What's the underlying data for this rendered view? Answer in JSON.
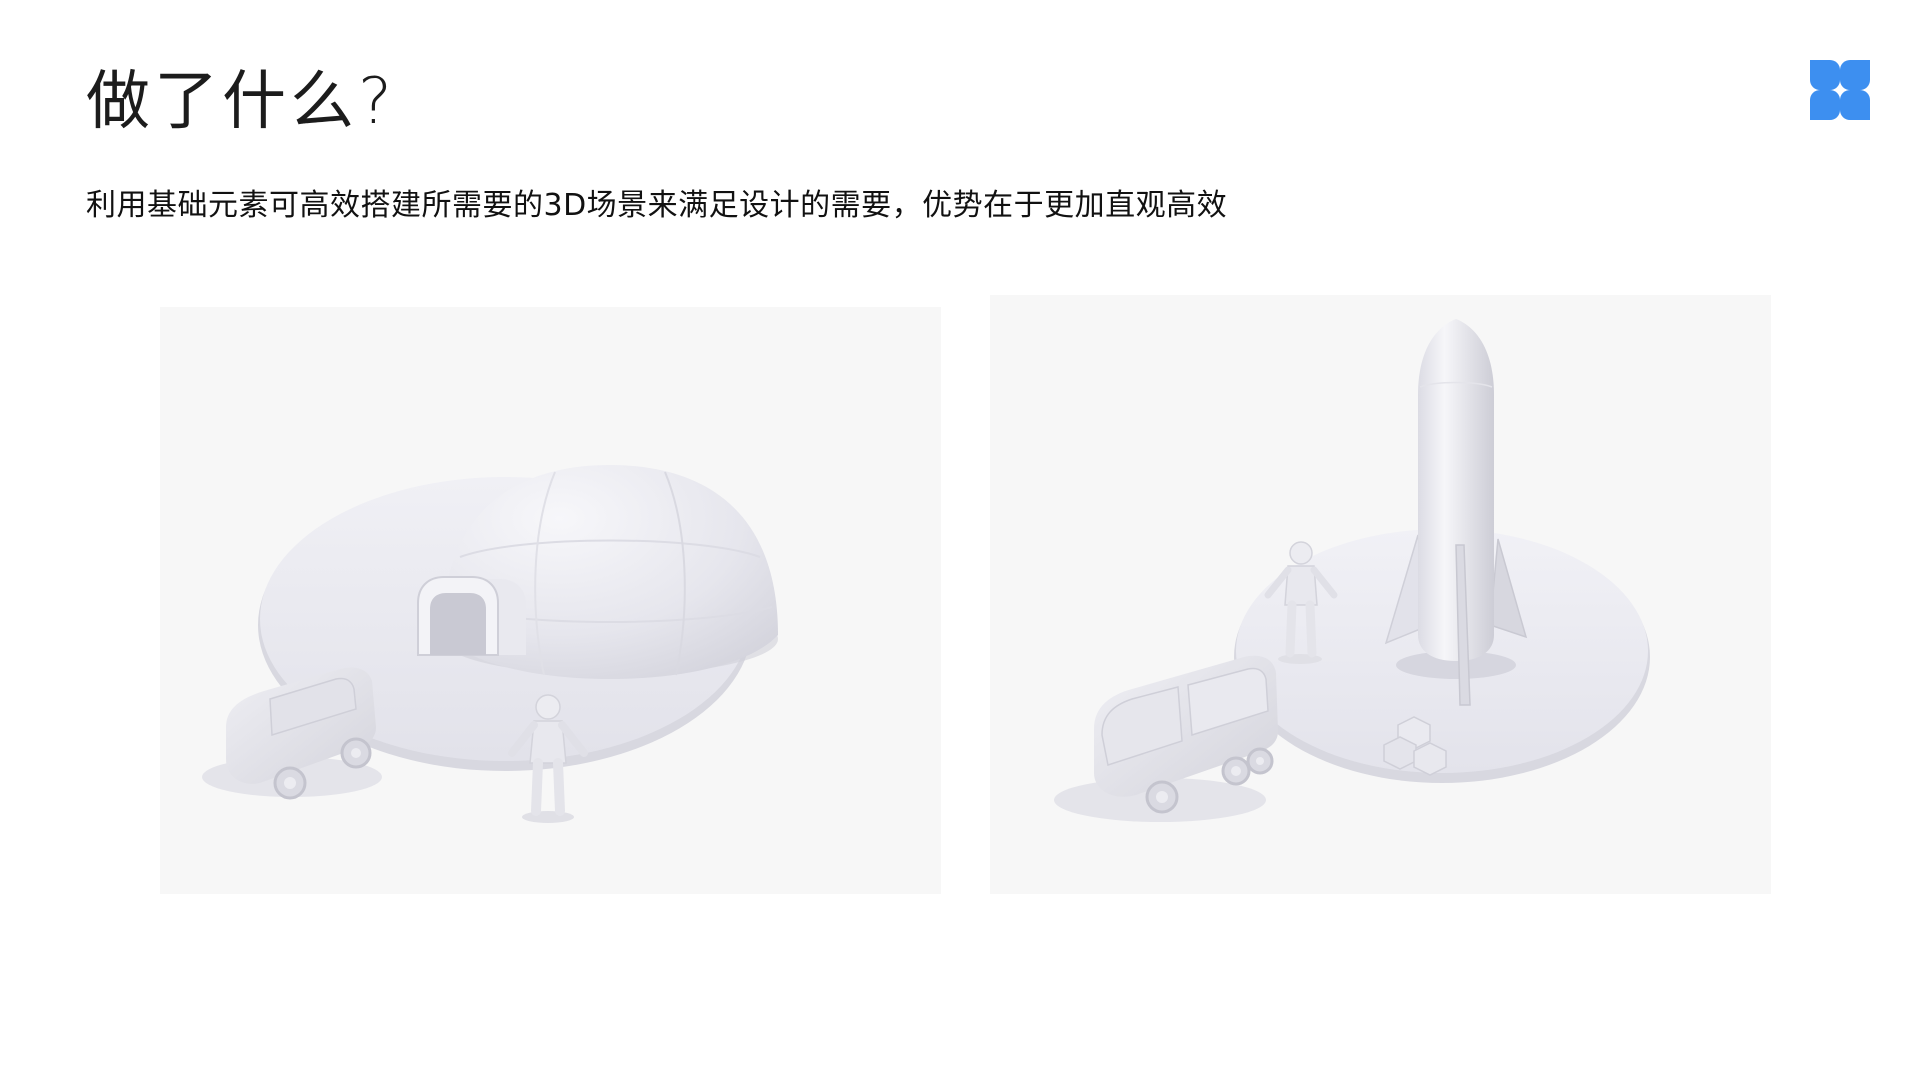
{
  "slide": {
    "title": "做了什么?",
    "subtitle": "利用基础元素可高效搭建所需要的3D场景来满足设计的需要，优势在于更加直观高效"
  },
  "logo": {
    "icon": "four-petal-logo-icon",
    "color": "#3d8ff0"
  },
  "scenes": [
    {
      "name": "igloo-dome-scene",
      "objects": [
        "disc-platform",
        "dome",
        "tunnel-entrance",
        "van",
        "astronaut"
      ]
    },
    {
      "name": "rocket-scene",
      "objects": [
        "disc-platform",
        "rocket",
        "van",
        "astronaut",
        "crates"
      ]
    }
  ],
  "colors": {
    "panel_bg": "#f7f7f7",
    "model_light": "#f2f2f6",
    "model_mid": "#e3e3ea",
    "model_shadow": "#cfcfd8"
  }
}
